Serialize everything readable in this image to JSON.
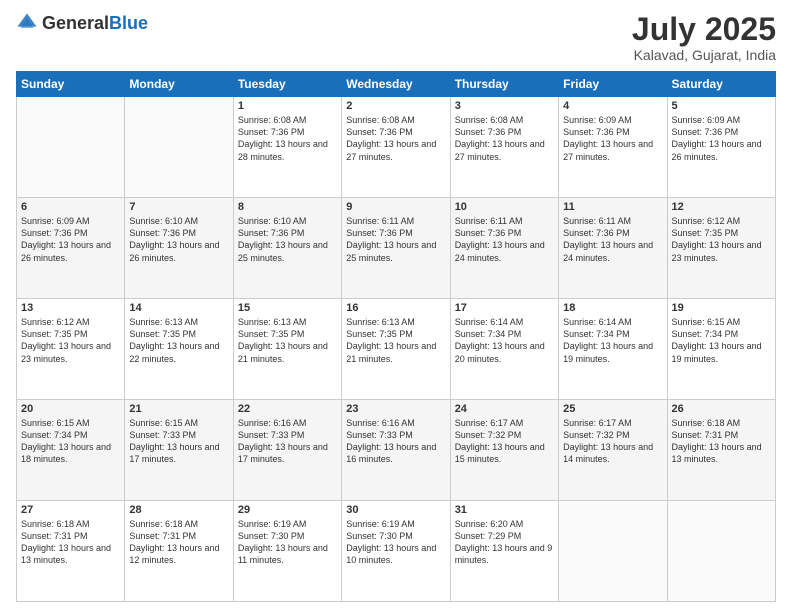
{
  "header": {
    "logo_general": "General",
    "logo_blue": "Blue",
    "month_year": "July 2025",
    "location": "Kalavad, Gujarat, India"
  },
  "days_of_week": [
    "Sunday",
    "Monday",
    "Tuesday",
    "Wednesday",
    "Thursday",
    "Friday",
    "Saturday"
  ],
  "weeks": [
    [
      {
        "day": "",
        "sunrise": "",
        "sunset": "",
        "daylight": ""
      },
      {
        "day": "",
        "sunrise": "",
        "sunset": "",
        "daylight": ""
      },
      {
        "day": "1",
        "sunrise": "Sunrise: 6:08 AM",
        "sunset": "Sunset: 7:36 PM",
        "daylight": "Daylight: 13 hours and 28 minutes."
      },
      {
        "day": "2",
        "sunrise": "Sunrise: 6:08 AM",
        "sunset": "Sunset: 7:36 PM",
        "daylight": "Daylight: 13 hours and 27 minutes."
      },
      {
        "day": "3",
        "sunrise": "Sunrise: 6:08 AM",
        "sunset": "Sunset: 7:36 PM",
        "daylight": "Daylight: 13 hours and 27 minutes."
      },
      {
        "day": "4",
        "sunrise": "Sunrise: 6:09 AM",
        "sunset": "Sunset: 7:36 PM",
        "daylight": "Daylight: 13 hours and 27 minutes."
      },
      {
        "day": "5",
        "sunrise": "Sunrise: 6:09 AM",
        "sunset": "Sunset: 7:36 PM",
        "daylight": "Daylight: 13 hours and 26 minutes."
      }
    ],
    [
      {
        "day": "6",
        "sunrise": "Sunrise: 6:09 AM",
        "sunset": "Sunset: 7:36 PM",
        "daylight": "Daylight: 13 hours and 26 minutes."
      },
      {
        "day": "7",
        "sunrise": "Sunrise: 6:10 AM",
        "sunset": "Sunset: 7:36 PM",
        "daylight": "Daylight: 13 hours and 26 minutes."
      },
      {
        "day": "8",
        "sunrise": "Sunrise: 6:10 AM",
        "sunset": "Sunset: 7:36 PM",
        "daylight": "Daylight: 13 hours and 25 minutes."
      },
      {
        "day": "9",
        "sunrise": "Sunrise: 6:11 AM",
        "sunset": "Sunset: 7:36 PM",
        "daylight": "Daylight: 13 hours and 25 minutes."
      },
      {
        "day": "10",
        "sunrise": "Sunrise: 6:11 AM",
        "sunset": "Sunset: 7:36 PM",
        "daylight": "Daylight: 13 hours and 24 minutes."
      },
      {
        "day": "11",
        "sunrise": "Sunrise: 6:11 AM",
        "sunset": "Sunset: 7:36 PM",
        "daylight": "Daylight: 13 hours and 24 minutes."
      },
      {
        "day": "12",
        "sunrise": "Sunrise: 6:12 AM",
        "sunset": "Sunset: 7:35 PM",
        "daylight": "Daylight: 13 hours and 23 minutes."
      }
    ],
    [
      {
        "day": "13",
        "sunrise": "Sunrise: 6:12 AM",
        "sunset": "Sunset: 7:35 PM",
        "daylight": "Daylight: 13 hours and 23 minutes."
      },
      {
        "day": "14",
        "sunrise": "Sunrise: 6:13 AM",
        "sunset": "Sunset: 7:35 PM",
        "daylight": "Daylight: 13 hours and 22 minutes."
      },
      {
        "day": "15",
        "sunrise": "Sunrise: 6:13 AM",
        "sunset": "Sunset: 7:35 PM",
        "daylight": "Daylight: 13 hours and 21 minutes."
      },
      {
        "day": "16",
        "sunrise": "Sunrise: 6:13 AM",
        "sunset": "Sunset: 7:35 PM",
        "daylight": "Daylight: 13 hours and 21 minutes."
      },
      {
        "day": "17",
        "sunrise": "Sunrise: 6:14 AM",
        "sunset": "Sunset: 7:34 PM",
        "daylight": "Daylight: 13 hours and 20 minutes."
      },
      {
        "day": "18",
        "sunrise": "Sunrise: 6:14 AM",
        "sunset": "Sunset: 7:34 PM",
        "daylight": "Daylight: 13 hours and 19 minutes."
      },
      {
        "day": "19",
        "sunrise": "Sunrise: 6:15 AM",
        "sunset": "Sunset: 7:34 PM",
        "daylight": "Daylight: 13 hours and 19 minutes."
      }
    ],
    [
      {
        "day": "20",
        "sunrise": "Sunrise: 6:15 AM",
        "sunset": "Sunset: 7:34 PM",
        "daylight": "Daylight: 13 hours and 18 minutes."
      },
      {
        "day": "21",
        "sunrise": "Sunrise: 6:15 AM",
        "sunset": "Sunset: 7:33 PM",
        "daylight": "Daylight: 13 hours and 17 minutes."
      },
      {
        "day": "22",
        "sunrise": "Sunrise: 6:16 AM",
        "sunset": "Sunset: 7:33 PM",
        "daylight": "Daylight: 13 hours and 17 minutes."
      },
      {
        "day": "23",
        "sunrise": "Sunrise: 6:16 AM",
        "sunset": "Sunset: 7:33 PM",
        "daylight": "Daylight: 13 hours and 16 minutes."
      },
      {
        "day": "24",
        "sunrise": "Sunrise: 6:17 AM",
        "sunset": "Sunset: 7:32 PM",
        "daylight": "Daylight: 13 hours and 15 minutes."
      },
      {
        "day": "25",
        "sunrise": "Sunrise: 6:17 AM",
        "sunset": "Sunset: 7:32 PM",
        "daylight": "Daylight: 13 hours and 14 minutes."
      },
      {
        "day": "26",
        "sunrise": "Sunrise: 6:18 AM",
        "sunset": "Sunset: 7:31 PM",
        "daylight": "Daylight: 13 hours and 13 minutes."
      }
    ],
    [
      {
        "day": "27",
        "sunrise": "Sunrise: 6:18 AM",
        "sunset": "Sunset: 7:31 PM",
        "daylight": "Daylight: 13 hours and 13 minutes."
      },
      {
        "day": "28",
        "sunrise": "Sunrise: 6:18 AM",
        "sunset": "Sunset: 7:31 PM",
        "daylight": "Daylight: 13 hours and 12 minutes."
      },
      {
        "day": "29",
        "sunrise": "Sunrise: 6:19 AM",
        "sunset": "Sunset: 7:30 PM",
        "daylight": "Daylight: 13 hours and 11 minutes."
      },
      {
        "day": "30",
        "sunrise": "Sunrise: 6:19 AM",
        "sunset": "Sunset: 7:30 PM",
        "daylight": "Daylight: 13 hours and 10 minutes."
      },
      {
        "day": "31",
        "sunrise": "Sunrise: 6:20 AM",
        "sunset": "Sunset: 7:29 PM",
        "daylight": "Daylight: 13 hours and 9 minutes."
      },
      {
        "day": "",
        "sunrise": "",
        "sunset": "",
        "daylight": ""
      },
      {
        "day": "",
        "sunrise": "",
        "sunset": "",
        "daylight": ""
      }
    ]
  ]
}
